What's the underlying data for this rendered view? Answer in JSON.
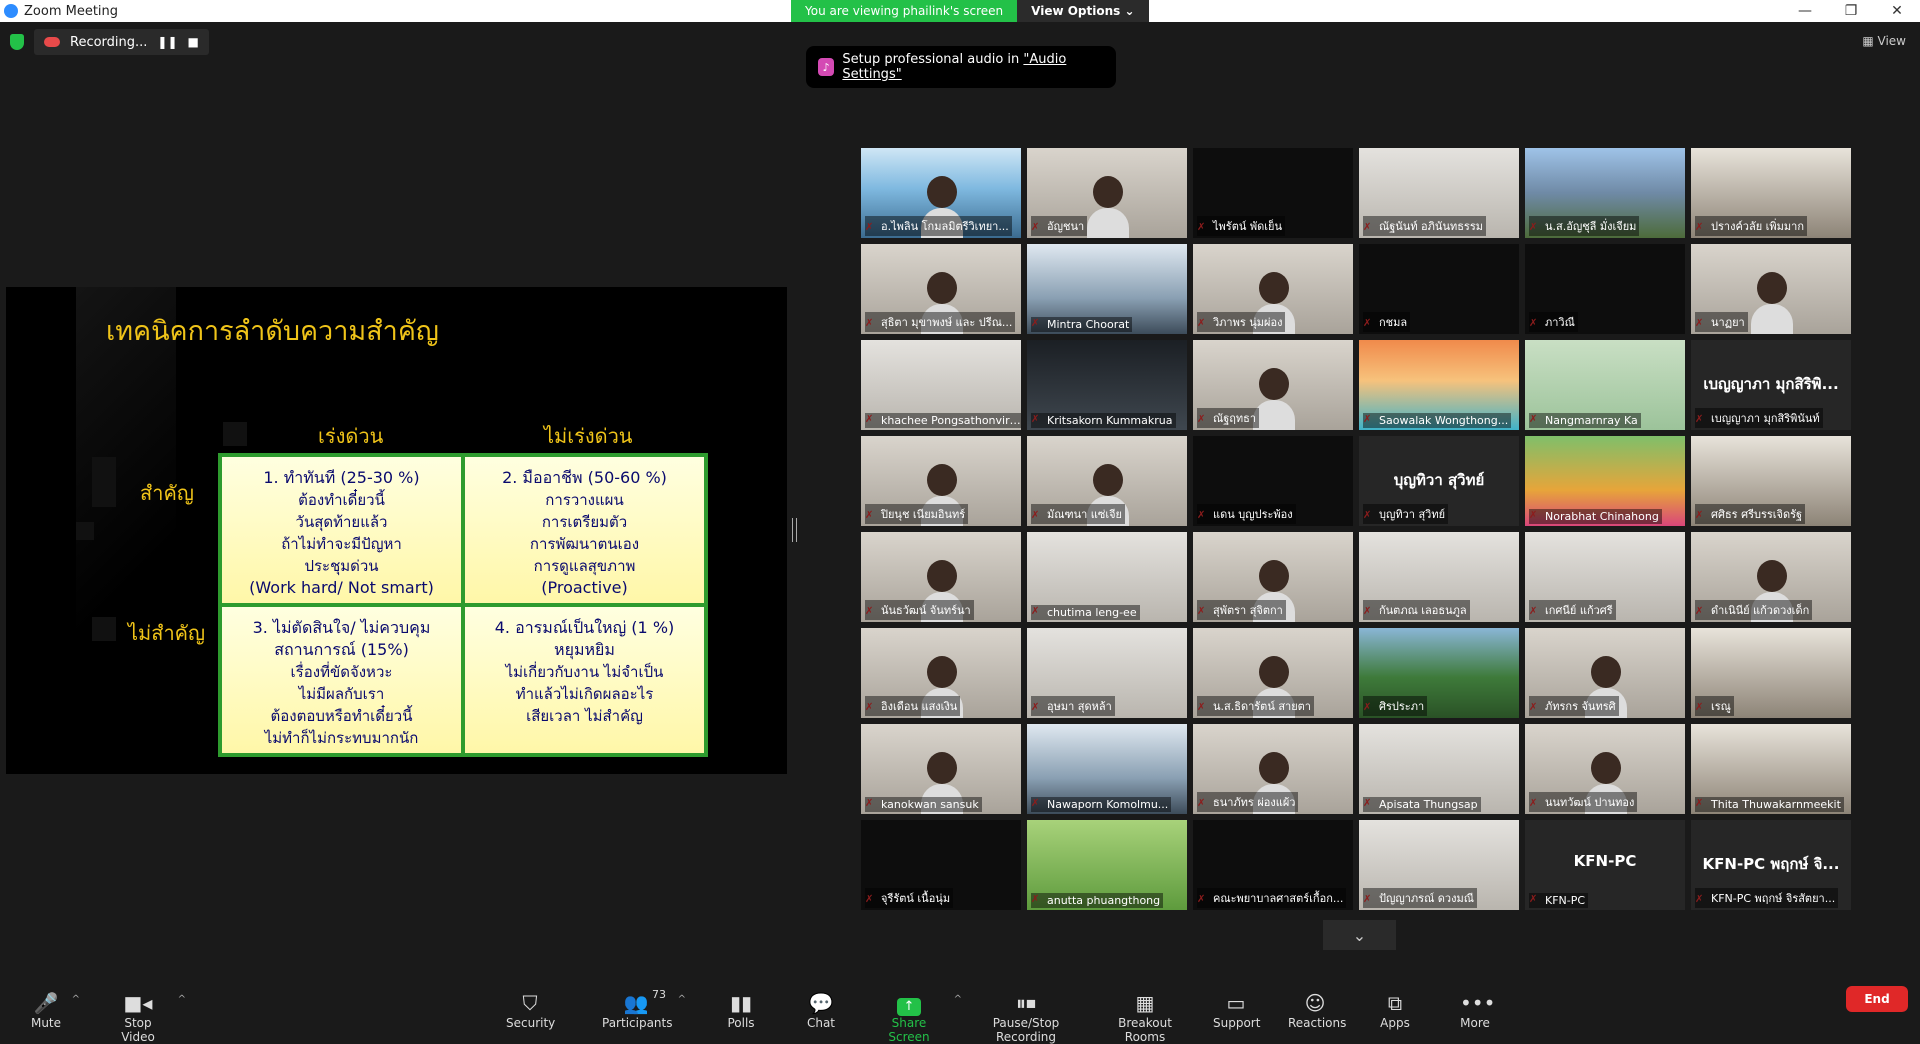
{
  "window": {
    "title": "Zoom Meeting",
    "min": "—",
    "max": "❐",
    "close": "✕"
  },
  "banner": {
    "viewing": "You are viewing phailink's screen",
    "options": "View Options ⌄"
  },
  "recording": {
    "label": "Recording...",
    "pause": "❚❚",
    "stop": "■"
  },
  "view_label": "▦ View",
  "audio_banner": {
    "prefix": "Setup professional audio in ",
    "link": "\"Audio Settings\""
  },
  "slide": {
    "title": "เทคนิคการลำดับความสำคัญ",
    "col_urgent": "เร่งด่วน",
    "col_not_urgent": "ไม่เร่งด่วน",
    "row_important": "สำคัญ",
    "row_not_important": "ไม่สำคัญ",
    "q1": [
      "1. ทำทันที  (25-30 %)",
      "ต้องทำเดี๋ยวนี้",
      "วันสุดท้ายแล้ว",
      "ถ้าไม่ทำจะมีปัญหา",
      "ประชุมด่วน",
      "(Work hard/ Not smart)"
    ],
    "q2": [
      "2.  มืออาชีพ (50-60 %)",
      "การวางแผน",
      "การเตรียมตัว",
      "การพัฒนาตนเอง",
      "การดูแลสุขภาพ",
      "(Proactive)"
    ],
    "q3": [
      "3. ไม่ตัดสินใจ/ ไม่ควบคุม",
      "สถานการณ์  (15%)",
      "เรื่องที่ขัดจังหวะ",
      "ไม่มีผลกับเรา",
      "ต้องตอบหรือทำเดี๋ยวนี้",
      "ไม่ทำก็ไม่กระทบมากนัก"
    ],
    "q4": [
      "4. อารมณ์เป็นใหญ่  (1 %)",
      "หยุมหยิม",
      "ไม่เกี่ยวกับงาน ไม่จำเป็น",
      "ทำแล้วไม่เกิดผลอะไร",
      "เสียเวลา ไม่สำคัญ"
    ]
  },
  "participants_grid": [
    {
      "name": "อ.ไพลิน โกมลมิตรีวิเทยา...",
      "big": "",
      "type": "presenter",
      "active": true
    },
    {
      "name": "อัญชนา",
      "big": "",
      "type": "person"
    },
    {
      "name": "ไพรัตน์ พัดเย็น",
      "big": "",
      "type": "black"
    },
    {
      "name": "ณัฐนันท์ อภินันทธรรม",
      "big": "",
      "type": "room"
    },
    {
      "name": "น.ส.อัญชุลี มั่งเจียม",
      "big": "",
      "type": "mountain"
    },
    {
      "name": "ปรางค์วลัย เพิ่มมาก",
      "big": "",
      "type": "office"
    },
    {
      "name": "สุธิตา มุขาพงษ์ และ ปรีณ...",
      "big": "",
      "type": "person"
    },
    {
      "name": "Mintra Choorat",
      "big": "",
      "type": "building"
    },
    {
      "name": "วิภาพร นุ่มผ่อง",
      "big": "",
      "type": "person"
    },
    {
      "name": "กชมล",
      "big": "",
      "type": "black"
    },
    {
      "name": "ภาวิณี",
      "big": "",
      "type": "black"
    },
    {
      "name": "นาฏยา",
      "big": "",
      "type": "person"
    },
    {
      "name": "khachee Pongsathonviriya...",
      "big": "",
      "type": "room"
    },
    {
      "name": "Kritsakorn Kummakrua",
      "big": "",
      "type": "city"
    },
    {
      "name": "ณัฐฤทธา",
      "big": "",
      "type": "person"
    },
    {
      "name": "Saowalak Wongthong...",
      "big": "",
      "type": "beach"
    },
    {
      "name": "Nangmarnray Ka",
      "big": "",
      "type": "green"
    },
    {
      "name": "เบญญาภา มุกสิริพินันท์",
      "big": "เบญญาภา มุกสิริพิ...",
      "type": "dark"
    },
    {
      "name": "ปิยนุช เนียมอินทร์",
      "big": "",
      "type": "person"
    },
    {
      "name": "มัณฑนา แซ่เจีย",
      "big": "",
      "type": "person"
    },
    {
      "name": "แดน บุญประพ้อง",
      "big": "",
      "type": "black"
    },
    {
      "name": "บุญทิวา สุวิทย์",
      "big": "บุญทิวา สุวิทย์",
      "type": "dark"
    },
    {
      "name": "Norabhat Chinahong",
      "big": "",
      "type": "flowers"
    },
    {
      "name": "ศศิธร ศรีบรรเจิดรัฐ",
      "big": "",
      "type": "office"
    },
    {
      "name": "นันธวัฒน์ จันทร์นา",
      "big": "",
      "type": "person"
    },
    {
      "name": "chutima leng-ee",
      "big": "",
      "type": "room"
    },
    {
      "name": "สุพัตรา สุจิตกา",
      "big": "",
      "type": "person"
    },
    {
      "name": "กันตภณ เลอธนภูล",
      "big": "",
      "type": "room"
    },
    {
      "name": "เกศนีย์ แก้วศรี",
      "big": "",
      "type": "room"
    },
    {
      "name": "ดำเนินีย์ แก้วดวงเด็ก",
      "big": "",
      "type": "person"
    },
    {
      "name": "อิงเดือน แสงเงิน",
      "big": "",
      "type": "person"
    },
    {
      "name": "อุษมา สุดหล้า",
      "big": "",
      "type": "room"
    },
    {
      "name": "น.ส.ธิดารัตน์ สายตา",
      "big": "",
      "type": "person"
    },
    {
      "name": "ศิรประภา",
      "big": "",
      "type": "forest"
    },
    {
      "name": "ภัทรกร จันทรศิ",
      "big": "",
      "type": "person"
    },
    {
      "name": "เรณู",
      "big": "",
      "type": "office"
    },
    {
      "name": "kanokwan sansuk",
      "big": "",
      "type": "person"
    },
    {
      "name": "Nawaporn Komolmu...",
      "big": "",
      "type": "building"
    },
    {
      "name": "ธนาภัทร ผ่องแผ้ว",
      "big": "",
      "type": "person"
    },
    {
      "name": "Apisata Thungsap",
      "big": "",
      "type": "room"
    },
    {
      "name": "นนทวัฒน์ ปานทอง",
      "big": "",
      "type": "person"
    },
    {
      "name": "Thita Thuwakarnmeekit",
      "big": "",
      "type": "office"
    },
    {
      "name": "จุรีรัตน์ เนื้อนุ่ม",
      "big": "",
      "type": "black"
    },
    {
      "name": "anutta phuangthong",
      "big": "",
      "type": "field"
    },
    {
      "name": "คณะพยาบาลศาสตร์เกื้อก...",
      "big": "",
      "type": "black"
    },
    {
      "name": "ปัญญาภรณ์ ดวงมณี",
      "big": "",
      "type": "room"
    },
    {
      "name": "KFN-PC",
      "big": "KFN-PC",
      "type": "dark"
    },
    {
      "name": "KFN-PC พฤกษ์ จิรสัตยา...",
      "big": "KFN-PC พฤกษ์ จิ...",
      "type": "dark"
    }
  ],
  "scroll_down": "⌄",
  "toolbar": {
    "mute": "Mute",
    "stop_video": "Stop Video",
    "security": "Security",
    "participants": "Participants",
    "participants_count": "73",
    "polls": "Polls",
    "chat": "Chat",
    "share_screen": "Share Screen",
    "pause_stop_recording": "Pause/Stop Recording",
    "breakout_rooms": "Breakout Rooms",
    "support": "Support",
    "reactions": "Reactions",
    "apps": "Apps",
    "more": "More",
    "end": "End"
  },
  "colors": {
    "accent_green": "#23c148",
    "active_speaker": "#b6e12a",
    "end_red": "#e02828",
    "slide_gold": "#f0c419"
  }
}
